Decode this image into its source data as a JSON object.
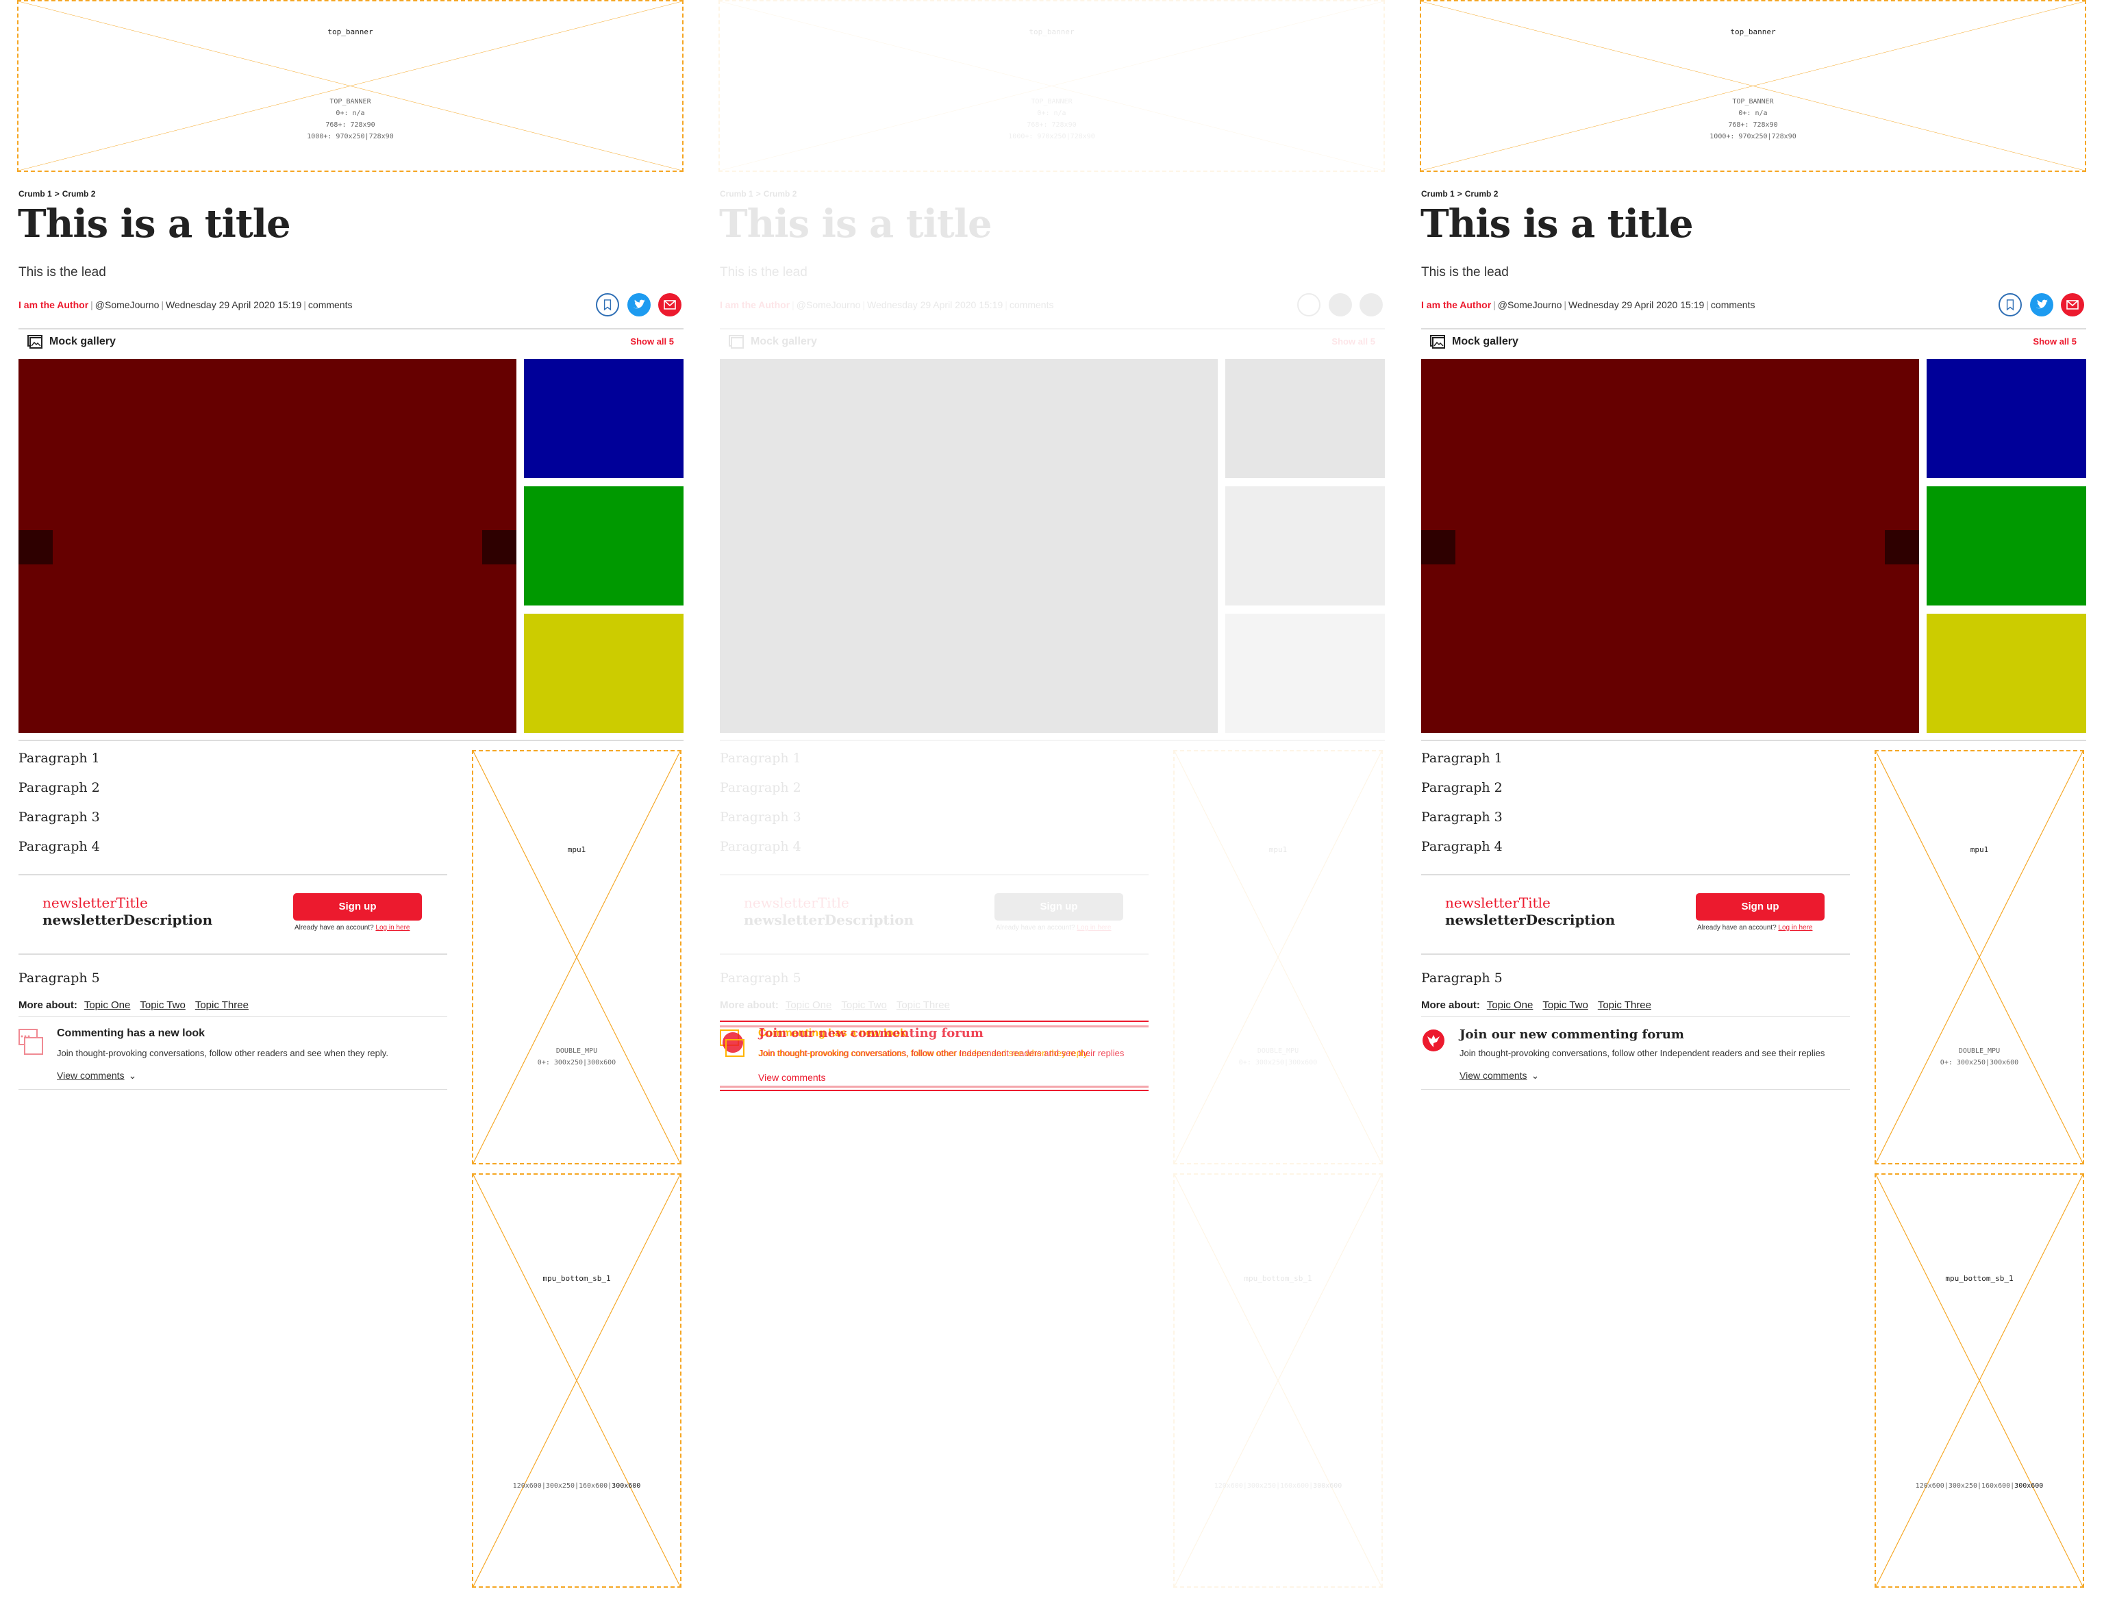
{
  "ads": {
    "top_banner": {
      "name": "top_banner",
      "spec": [
        "TOP_BANNER",
        "0+: n/a",
        "768+: 728x90",
        "1000+: 970x250|728x90"
      ]
    },
    "mpu1": {
      "name": "mpu1",
      "spec_type": "DOUBLE_MPU",
      "spec_sizes": "0+: 300x250|300x600"
    },
    "mpu_bottom": {
      "name": "mpu_bottom_sb_1",
      "spec_sizes": "120x600|300x250|160x600|",
      "spec_highlight": "300x600"
    }
  },
  "article": {
    "crumbs": [
      "Crumb 1",
      "Crumb 2"
    ],
    "crumb_sep": ">",
    "title": "This is a title",
    "lead": "This is the lead",
    "author": "I am the Author",
    "handle": "@SomeJourno",
    "date": "Wednesday 29 April 2020 15:19",
    "comments_link": "comments",
    "share_icons": [
      "bookmark-icon",
      "twitter-icon",
      "email-icon"
    ]
  },
  "gallery": {
    "title": "Mock gallery",
    "show_all": "Show all 5",
    "tiles": [
      {
        "color": "#660000"
      },
      {
        "color": "#000099"
      },
      {
        "color": "#009900"
      },
      {
        "color": "#cccc00"
      }
    ]
  },
  "paragraphs": [
    "Paragraph 1",
    "Paragraph 2",
    "Paragraph 3",
    "Paragraph 4",
    "Paragraph 5"
  ],
  "newsletter": {
    "title": "newsletterTitle",
    "description": "newsletterDescription",
    "button": "Sign up",
    "account_text": "Already have an account?",
    "login_link": "Log in here"
  },
  "more_about": {
    "label": "More about:",
    "topics": [
      "Topic One",
      "Topic Two",
      "Topic Three"
    ]
  },
  "comments_before": {
    "title": "Commenting has a new look",
    "description": "Join thought-provoking conversations, follow other readers and see when they reply.",
    "view": "View comments"
  },
  "comments_after": {
    "title": "Join our new commenting forum",
    "description": "Join thought-provoking conversations, follow other Independent readers and see their replies",
    "view": "View comments"
  },
  "colors": {
    "brand_red": "#ec1a2e",
    "ad_outline": "#f5a623",
    "twitter": "#1d9bf0",
    "bookmark": "#2f6fb5"
  }
}
